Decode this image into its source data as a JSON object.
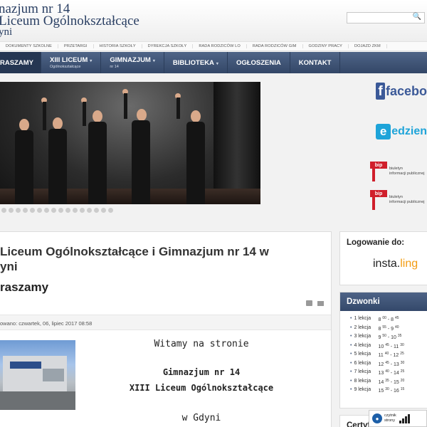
{
  "header": {
    "logo_line1": "nazjum nr 14",
    "logo_line2": "Liceum Ogólnokształcące",
    "logo_line3": "yni",
    "search_placeholder": ""
  },
  "topnav": [
    "DOKUMENTY SZKOLNE",
    "PRZETARGI",
    "HISTORIA SZKOŁY",
    "DYREKCJA SZKOŁY",
    "RADA RODZICÓW LO",
    "RADA RODZICÓW GIM",
    "GODZINY PRACY",
    "DOJAZD ZKM"
  ],
  "mainnav": {
    "active": "RASZAMY",
    "items": [
      {
        "label": "XIII LICEUM",
        "sub": "Ogólnokształcące"
      },
      {
        "label": "GIMNAZJUM",
        "sub": "nr 14"
      },
      {
        "label": "BIBLIOTEKA",
        "sub": ""
      },
      {
        "label": "OGŁOSZENIA",
        "sub": ""
      },
      {
        "label": "KONTAKT",
        "sub": ""
      }
    ]
  },
  "sidebar_banners": {
    "facebook": "facebo",
    "edziennik": "edzien",
    "bip_mark": "bip",
    "bip_line1": "biuletyn",
    "bip_line2": "informacji publicznej"
  },
  "article": {
    "title_line1": "Liceum Ogólnokształcące i Gimnazjum nr 14 w",
    "title_line2": "yni",
    "subtitle": "raszamy",
    "meta": "owano: czwartek, 06, lipiec 2017 08:58",
    "welcome": "Witamy na stronie",
    "school1": "Gimnazjum nr 14",
    "school2": "XIII Liceum Ogólnokształcące",
    "city": "w Gdyni"
  },
  "login": {
    "title": "Logowanie do:",
    "insta": "insta.",
    "ling": "ling"
  },
  "bells": {
    "title": "Dzwonki",
    "rows": [
      {
        "lesson": "1 lekcja",
        "sh": "8",
        "sm": "00",
        "eh": "8",
        "em": "45"
      },
      {
        "lesson": "2 lekcja",
        "sh": "8",
        "sm": "55",
        "eh": "9",
        "em": "40"
      },
      {
        "lesson": "3 lekcja",
        "sh": "9",
        "sm": "50",
        "eh": "10",
        "em": "35"
      },
      {
        "lesson": "4 lekcja",
        "sh": "10",
        "sm": "45",
        "eh": "11",
        "em": "30"
      },
      {
        "lesson": "5 lekcja",
        "sh": "11",
        "sm": "40",
        "eh": "12",
        "em": "25"
      },
      {
        "lesson": "6 lekcja",
        "sh": "12",
        "sm": "45",
        "eh": "13",
        "em": "30"
      },
      {
        "lesson": "7 lekcja",
        "sh": "13",
        "sm": "40",
        "eh": "14",
        "em": "25"
      },
      {
        "lesson": "8 lekcja",
        "sh": "14",
        "sm": "35",
        "eh": "15",
        "em": "20"
      },
      {
        "lesson": "9 lekcja",
        "sh": "15",
        "sm": "30",
        "eh": "16",
        "em": "15"
      }
    ]
  },
  "cert": {
    "title": "Certyf"
  },
  "reader": {
    "line1": "czytnik",
    "line2": "strony"
  }
}
